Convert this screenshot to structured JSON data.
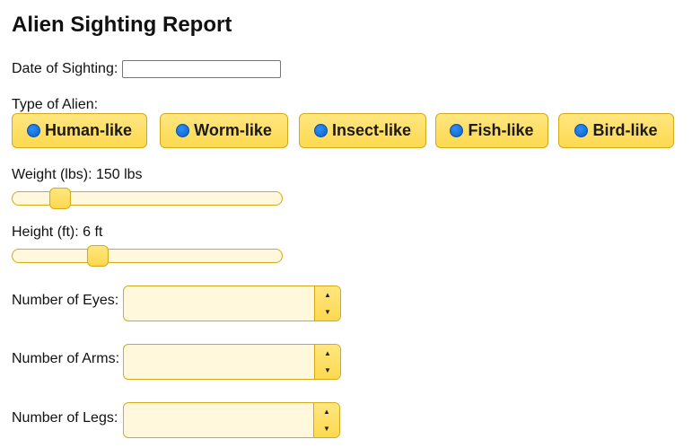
{
  "title": "Alien Sighting Report",
  "date": {
    "label": "Date of Sighting:",
    "value": ""
  },
  "alien_type": {
    "label": "Type of Alien:",
    "options": [
      {
        "label": "Human-like"
      },
      {
        "label": "Worm-like"
      },
      {
        "label": "Insect-like"
      },
      {
        "label": "Fish-like"
      },
      {
        "label": "Bird-like"
      }
    ]
  },
  "weight": {
    "label": "Weight (lbs): 150 lbs",
    "value": 150,
    "fraction": 0.15
  },
  "height": {
    "label": "Height (ft): 6 ft",
    "value": 6,
    "fraction": 0.3
  },
  "eyes": {
    "label": "Number of Eyes:",
    "value": ""
  },
  "arms": {
    "label": "Number of Arms:",
    "value": ""
  },
  "legs": {
    "label": "Number of Legs:",
    "value": ""
  },
  "icons": {
    "radio": "radio-selected-icon",
    "spin_up": "spin-up-icon",
    "spin_down": "spin-down-icon"
  },
  "colors": {
    "accent": "#fdd94f",
    "accent_border": "#d4a91a",
    "field_bg": "#fff8dc",
    "radio_dot": "#0a5fc9"
  }
}
